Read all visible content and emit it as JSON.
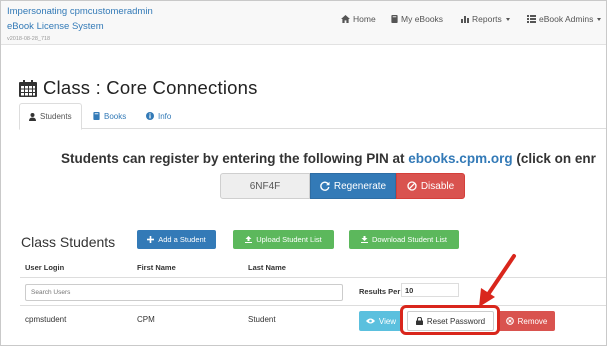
{
  "header": {
    "impersonating": "Impersonating cpmcustomeradmin",
    "app_name": "eBook License System",
    "version": "v2018-08-28_718",
    "nav": {
      "home": "Home",
      "my_ebooks": "My eBooks",
      "reports": "Reports",
      "ebook_admins": "eBook Admins"
    }
  },
  "page": {
    "title": "Class : Core Connections",
    "tabs": [
      "Students",
      "Books",
      "Info"
    ],
    "pin_message_prefix": "Students can register by entering the following PIN at ",
    "pin_link": "ebooks.cpm.org",
    "pin_message_suffix": " (click on enr",
    "pin": "6NF4F",
    "regenerate_label": "Regenerate",
    "disable_label": "Disable"
  },
  "students": {
    "section_title": "Class Students",
    "add_label": "Add a Student",
    "upload_label": "Upload Student List",
    "download_label": "Download Student List",
    "columns": [
      "User Login",
      "First Name",
      "Last Name"
    ],
    "search_placeholder": "Search Users",
    "results_per_page_label": "Results Per Page:",
    "results_per_page_value": "10",
    "rows": [
      {
        "login": "cpmstudent",
        "first": "CPM",
        "last": "Student"
      }
    ],
    "view_label": "View",
    "reset_label": "Reset Password",
    "remove_label": "Remove"
  },
  "colors": {
    "primary": "#337ab7",
    "success": "#5cb85c",
    "danger": "#d9534f",
    "info": "#5bc0de",
    "annotation": "#d9261c"
  }
}
